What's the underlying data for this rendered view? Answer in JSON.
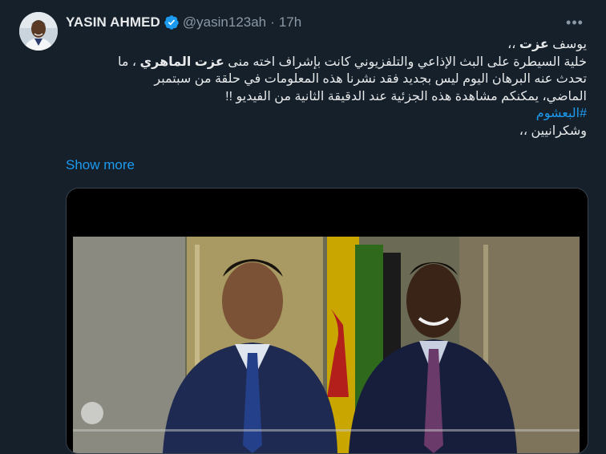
{
  "author": {
    "name": "YASIN AHMED",
    "handle": "@yasin123ah",
    "separator": "·",
    "time": "17h"
  },
  "more_icon": "more-horizontal-icon",
  "tweet": {
    "line1_prefix": "يوسف ",
    "line1_bold": "عزت",
    "line1_suffix": " ،،",
    "line2": "خلية السيطرة على البث الإذاعي والتلفزيوني كانت بإشراف اخته منى ",
    "line2_bold": "عزت الماهري",
    "line2_suffix": " ، ما",
    "line3": "تحدث عنه البرهان اليوم ليس بجديد فقد نشرنا هذه المعلومات في حلقة من سبتمبر",
    "line4": "الماضي، يمكنكم مشاهدة هذه الجزئية عند الدقيقة الثانية من الفيديو !!",
    "hashtag": "#البعشوم",
    "closing": "وشكرانيين ،،"
  },
  "show_more": "Show more",
  "colors": {
    "background": "#15202b",
    "text": "#e7e9ea",
    "secondary": "#8b98a5",
    "accent": "#1d9bf0",
    "border": "#38444d"
  }
}
